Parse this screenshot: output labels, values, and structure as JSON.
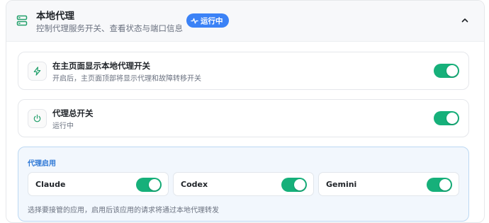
{
  "header": {
    "title": "本地代理",
    "subtitle": "控制代理服务开关、查看状态与端口信息",
    "status_badge": "运行中"
  },
  "settings": [
    {
      "title": "在主页面显示本地代理开关",
      "description": "开启后，主页面顶部将显示代理和故障转移开关",
      "icon": "lightning-icon",
      "enabled": true
    },
    {
      "title": "代理总开关",
      "description": "运行中",
      "icon": "power-icon",
      "enabled": true
    }
  ],
  "apps_section": {
    "title": "代理启用",
    "apps": [
      {
        "name": "Claude",
        "enabled": true
      },
      {
        "name": "Codex",
        "enabled": true
      },
      {
        "name": "Gemini",
        "enabled": true
      }
    ],
    "note": "选择要接管的应用，启用后该应用的请求将通过本地代理转发"
  },
  "colors": {
    "toggle_on": "#16b07a",
    "badge": "#3b82f6",
    "section_accent": "#2e78d6",
    "icon_accent": "#22a06b"
  }
}
